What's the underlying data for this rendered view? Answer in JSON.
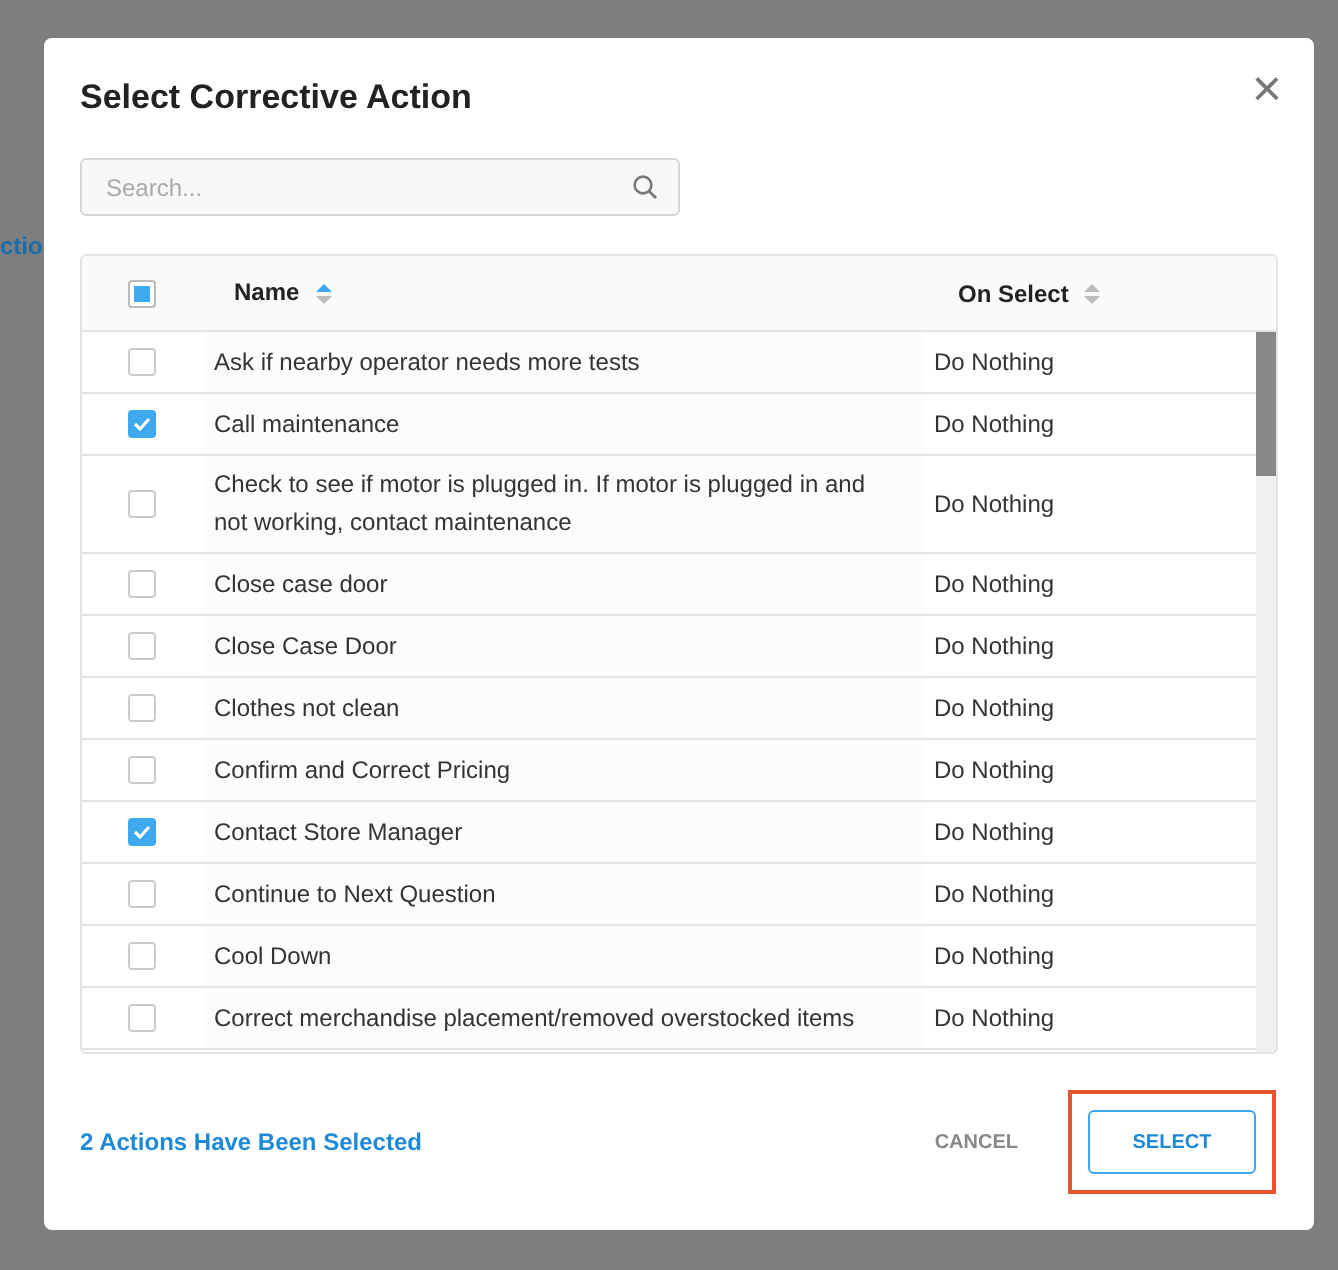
{
  "background": {
    "link_text": "ctio"
  },
  "dialog": {
    "title": "Select Corrective Action",
    "close": "×"
  },
  "search": {
    "placeholder": "Search..."
  },
  "table": {
    "select_all": {
      "checked": false,
      "indeterminate": true
    },
    "columns": [
      {
        "label": "Name",
        "sorted": true
      },
      {
        "label": "On Select",
        "sorted": false
      }
    ],
    "rows": [
      {
        "name": "Ask if nearby operator needs more tests",
        "on_select": "Do Nothing",
        "checked": false
      },
      {
        "name": "Call maintenance",
        "on_select": "Do Nothing",
        "checked": true
      },
      {
        "name": "Check to see if motor is plugged in. If motor is plugged in and not working, contact maintenance",
        "on_select": "Do Nothing",
        "checked": false
      },
      {
        "name": "Close case door",
        "on_select": "Do Nothing",
        "checked": false
      },
      {
        "name": "Close Case Door",
        "on_select": "Do Nothing",
        "checked": false
      },
      {
        "name": "Clothes not clean",
        "on_select": "Do Nothing",
        "checked": false
      },
      {
        "name": "Confirm and Correct Pricing",
        "on_select": "Do Nothing",
        "checked": false
      },
      {
        "name": "Contact Store Manager",
        "on_select": "Do Nothing",
        "checked": true
      },
      {
        "name": "Continue to Next Question",
        "on_select": "Do Nothing",
        "checked": false
      },
      {
        "name": "Cool Down",
        "on_select": "Do Nothing",
        "checked": false
      },
      {
        "name": "Correct merchandise placement/removed overstocked items",
        "on_select": "Do Nothing",
        "checked": false
      }
    ]
  },
  "footer": {
    "status": "2 Actions Have Been Selected",
    "buttons": [
      {
        "label": "CANCEL",
        "kind": "text"
      },
      {
        "label": "SELECT",
        "kind": "outline",
        "highlighted": true
      }
    ]
  }
}
